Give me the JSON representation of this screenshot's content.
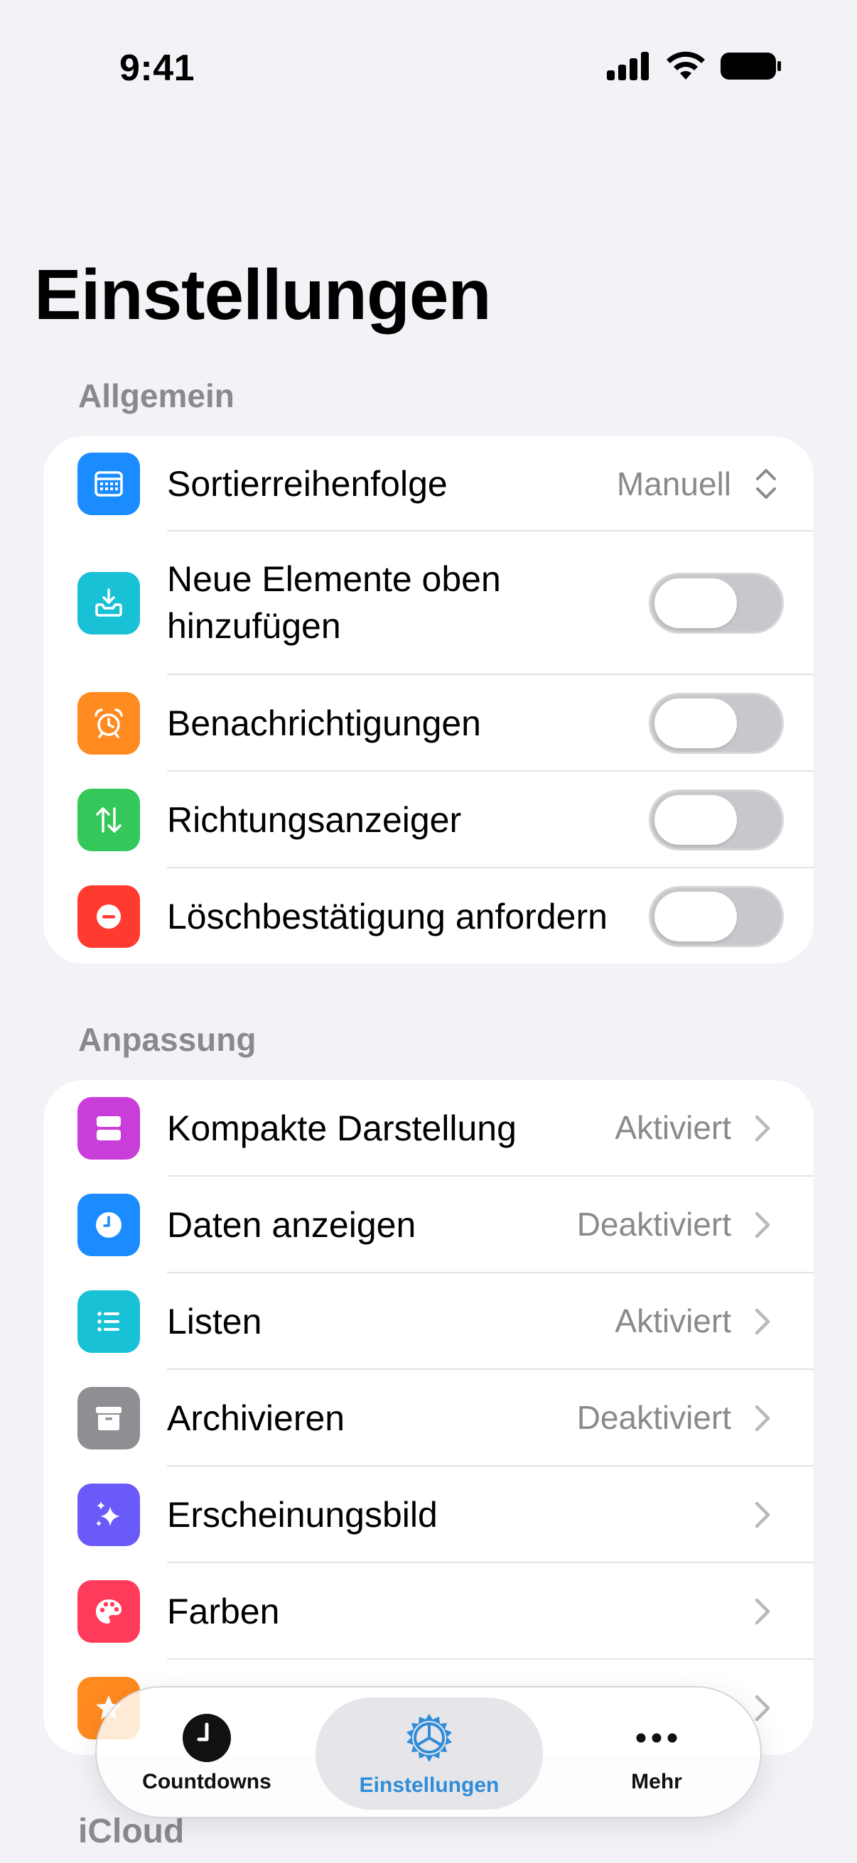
{
  "status_bar": {
    "time": "9:41"
  },
  "page_title": "Einstellungen",
  "sections": {
    "general": {
      "header": "Allgemein",
      "rows": {
        "sort": {
          "label": "Sortierreihenfolge",
          "value": "Manuell",
          "icon": "calendar-icon",
          "color": "#1A8CFF"
        },
        "new_top": {
          "label_line1": "Neue Elemente oben",
          "label_line2": "hinzufügen",
          "icon": "tray-download-icon",
          "color": "#19C1D6",
          "toggle_on": false
        },
        "notifications": {
          "label": "Benachrichtigungen",
          "icon": "alarm-clock-icon",
          "color": "#FF8A1F",
          "toggle_on": false
        },
        "direction": {
          "label": "Richtungsanzeiger",
          "icon": "up-down-arrows-icon",
          "color": "#34C759",
          "toggle_on": false
        },
        "delete_confirm": {
          "label": "Löschbestätigung anfordern",
          "icon": "minus-circle-icon",
          "color": "#FF3B30",
          "toggle_on": false
        }
      }
    },
    "customization": {
      "header": "Anpassung",
      "rows": {
        "compact": {
          "label": "Kompakte Darstellung",
          "value": "Aktiviert",
          "icon": "compact-view-icon",
          "color": "#C93ED9"
        },
        "show_dates": {
          "label": "Daten anzeigen",
          "value": "Deaktiviert",
          "icon": "clock-icon",
          "color": "#1A8CFF"
        },
        "lists": {
          "label": "Listen",
          "value": "Aktiviert",
          "icon": "list-icon",
          "color": "#19C1D6"
        },
        "archive": {
          "label": "Archivieren",
          "value": "Deaktiviert",
          "icon": "archive-box-icon",
          "color": "#8E8E93"
        },
        "appearance": {
          "label": "Erscheinungsbild",
          "icon": "sparkles-icon",
          "color": "#6A5AF9"
        },
        "colors": {
          "label": "Farben",
          "icon": "palette-icon",
          "color": "#FF3B5C"
        },
        "more": {
          "icon": "star-icon",
          "color": "#FF8A1F"
        }
      }
    },
    "icloud": {
      "header": "iCloud"
    }
  },
  "tab_bar": {
    "tabs": [
      {
        "label": "Countdowns",
        "icon": "clock-icon",
        "active": false
      },
      {
        "label": "Einstellungen",
        "icon": "gear-icon",
        "active": true
      },
      {
        "label": "Mehr",
        "icon": "more-dots-icon",
        "active": false
      }
    ],
    "accent_color": "#2F8CD8"
  }
}
